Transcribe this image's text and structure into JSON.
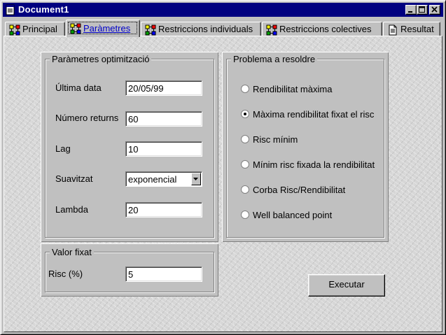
{
  "window": {
    "title": "Document1",
    "icon": "document-icon",
    "controls": [
      "minimize-icon",
      "maximize-icon",
      "close-icon"
    ]
  },
  "tabs": [
    {
      "label": "Principal",
      "icon": "network-grid-icon",
      "active": false
    },
    {
      "label": "Paràmetres",
      "icon": "network-grid-icon",
      "active": true
    },
    {
      "label": "Restriccions individuals",
      "icon": "network-grid-icon",
      "active": false
    },
    {
      "label": "Restriccions colectives",
      "icon": "network-grid-icon",
      "active": false
    },
    {
      "label": "Resultat",
      "icon": "document-icon",
      "active": false
    }
  ],
  "params": {
    "title": "Paràmetres optimització",
    "last_date_label": "Última data",
    "last_date_value": "20/05/99",
    "num_returns_label": "Número returns",
    "num_returns_value": "60",
    "lag_label": "Lag",
    "lag_value": "10",
    "smoothing_label": "Suavitzat",
    "smoothing_value": "exponencial",
    "lambda_label": "Lambda",
    "lambda_value": "20"
  },
  "problem": {
    "title": "Problema a resoldre",
    "options": [
      {
        "label": "Rendibilitat màxima",
        "selected": false
      },
      {
        "label": "Màxima rendibilitat fixat el risc",
        "selected": true
      },
      {
        "label": "Risc mínim",
        "selected": false
      },
      {
        "label": "Mínim risc fixada la rendibilitat",
        "selected": false
      },
      {
        "label": "Corba Risc/Rendibilitat",
        "selected": false
      },
      {
        "label": "Well balanced point",
        "selected": false
      }
    ]
  },
  "fixed": {
    "title": "Valor fixat",
    "risk_label": "Risc (%)",
    "risk_value": "5"
  },
  "actions": {
    "execute_label": "Executar"
  }
}
